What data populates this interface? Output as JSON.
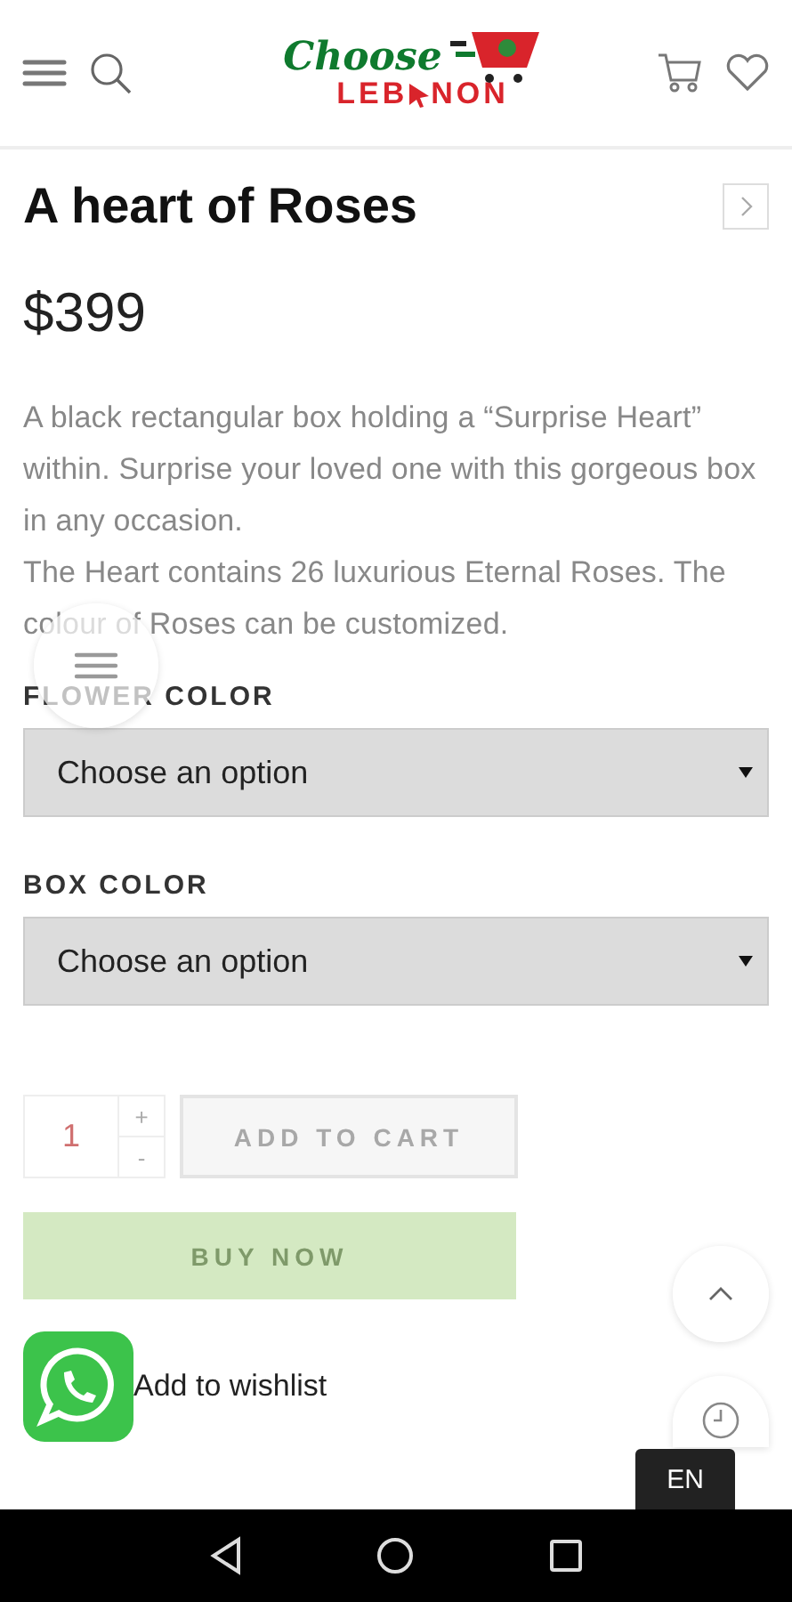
{
  "header": {
    "logo_top": "Choose",
    "logo_left": "LEB",
    "logo_right": "NON"
  },
  "product": {
    "title": "A heart of Roses",
    "price": "$399",
    "description": [
      "A black rectangular box holding a “Surprise Heart” within. Surprise your loved one with this gorgeous box in any occasion.",
      "The Heart contains 26 luxurious Eternal Roses. The colour of Roses can be customized."
    ]
  },
  "options": [
    {
      "label": "FLOWER COLOR",
      "value": "Choose an option"
    },
    {
      "label": "BOX COLOR",
      "value": "Choose an option"
    }
  ],
  "quantity": {
    "value": "1",
    "increment": "+",
    "decrement": "-"
  },
  "add_to_cart": {
    "label": "ADD TO CART",
    "disabled": true
  },
  "buy_now": {
    "label": "BUY NOW",
    "disabled": true
  },
  "wishlist": "Add to wishlist",
  "language": "EN"
}
